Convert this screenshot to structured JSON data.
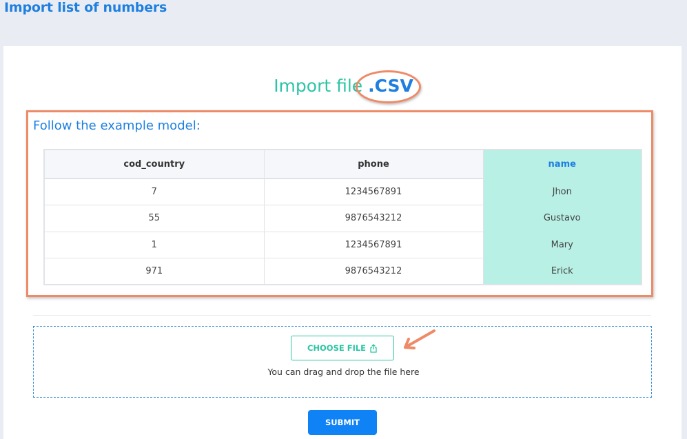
{
  "header": {
    "title": "Import list of numbers"
  },
  "import": {
    "prefix": "Import file ",
    "extension": ".CSV"
  },
  "example": {
    "title": "Follow the example model:",
    "columns": [
      "cod_country",
      "phone",
      "name"
    ],
    "rows": [
      [
        "7",
        "1234567891",
        "Jhon"
      ],
      [
        "55",
        "9876543212",
        "Gustavo"
      ],
      [
        "1",
        "1234567891",
        "Mary"
      ],
      [
        "971",
        "9876543212",
        "Erick"
      ]
    ]
  },
  "upload": {
    "choose_label": "CHOOSE FILE",
    "choose_icon": "upload-icon",
    "hint": "You can drag and drop the file here"
  },
  "actions": {
    "submit_label": "SUBMIT"
  },
  "colors": {
    "accent_blue": "#1e7fe0",
    "accent_teal": "#2cc5a5",
    "highlight_column": "#b8f0e6",
    "annotation": "#ee8a66",
    "submit_bg": "#0f82f5"
  }
}
